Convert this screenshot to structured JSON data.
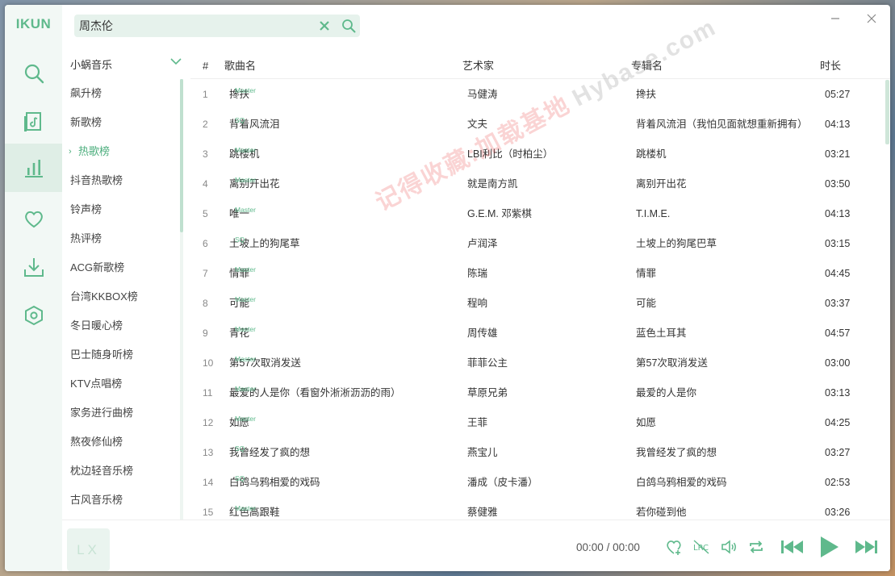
{
  "app": {
    "brand": "IKUN"
  },
  "search": {
    "value": "周杰伦",
    "placeholder": ""
  },
  "source": {
    "selected": "小蜗音乐"
  },
  "charts": [
    {
      "label": "飙升榜",
      "active": false
    },
    {
      "label": "新歌榜",
      "active": false
    },
    {
      "label": "热歌榜",
      "active": true
    },
    {
      "label": "抖音热歌榜",
      "active": false
    },
    {
      "label": "铃声榜",
      "active": false
    },
    {
      "label": "热评榜",
      "active": false
    },
    {
      "label": "ACG新歌榜",
      "active": false
    },
    {
      "label": "台湾KKBOX榜",
      "active": false
    },
    {
      "label": "冬日暖心榜",
      "active": false
    },
    {
      "label": "巴士随身听榜",
      "active": false
    },
    {
      "label": "KTV点唱榜",
      "active": false
    },
    {
      "label": "家务进行曲榜",
      "active": false
    },
    {
      "label": "熬夜修仙榜",
      "active": false
    },
    {
      "label": "枕边轻音乐榜",
      "active": false
    },
    {
      "label": "古风音乐榜",
      "active": false
    }
  ],
  "table": {
    "headers": {
      "num": "#",
      "name": "歌曲名",
      "artist": "艺术家",
      "album": "专辑名",
      "duration": "时长"
    },
    "rows": [
      {
        "num": "1",
        "name": "搀扶",
        "quality": "Master",
        "artist": "马健涛",
        "album": "搀扶",
        "duration": "05:27"
      },
      {
        "num": "2",
        "name": "背着风流泪",
        "quality": "SQ",
        "artist": "文夫",
        "album": "背着风流泪（我怕见面就想重新拥有）",
        "duration": "04:13"
      },
      {
        "num": "3",
        "name": "跳楼机",
        "quality": "Master",
        "artist": "LBI利比（时柏尘）",
        "album": "跳楼机",
        "duration": "03:21"
      },
      {
        "num": "4",
        "name": "离别开出花",
        "quality": "Master",
        "artist": "就是南方凯",
        "album": "离别开出花",
        "duration": "03:50"
      },
      {
        "num": "5",
        "name": "唯一",
        "quality": "Master",
        "artist": "G.E.M. 邓紫棋",
        "album": "T.I.M.E.",
        "duration": "04:13"
      },
      {
        "num": "6",
        "name": "土坡上的狗尾草",
        "quality": "SQ",
        "artist": "卢润泽",
        "album": "土坡上的狗尾巴草",
        "duration": "03:15"
      },
      {
        "num": "7",
        "name": "情罪",
        "quality": "Master",
        "artist": "陈瑞",
        "album": "情罪",
        "duration": "04:45"
      },
      {
        "num": "8",
        "name": "可能",
        "quality": "Master",
        "artist": "程响",
        "album": "可能",
        "duration": "03:37"
      },
      {
        "num": "9",
        "name": "青花",
        "quality": "Master",
        "artist": "周传雄",
        "album": "蓝色土耳其",
        "duration": "04:57"
      },
      {
        "num": "10",
        "name": "第57次取消发送",
        "quality": "Master",
        "artist": "菲菲公主",
        "album": "第57次取消发送",
        "duration": "03:00"
      },
      {
        "num": "11",
        "name": "最爱的人是你（看窗外淅淅沥沥的雨）",
        "quality": "Master",
        "artist": "草原兄弟",
        "album": "最爱的人是你",
        "duration": "03:13"
      },
      {
        "num": "12",
        "name": "如愿",
        "quality": "Master",
        "artist": "王菲",
        "album": "如愿",
        "duration": "04:25"
      },
      {
        "num": "13",
        "name": "我曾经发了疯的想",
        "quality": "SQ",
        "artist": "燕宝儿",
        "album": "我曾经发了疯的想",
        "duration": "03:27"
      },
      {
        "num": "14",
        "name": "白鸽乌鸦相爱的戏码",
        "quality": "SQ",
        "artist": "潘成（皮卡潘）",
        "album": "白鸽乌鸦相爱的戏码",
        "duration": "02:53"
      },
      {
        "num": "15",
        "name": "红色高跟鞋",
        "quality": "Master",
        "artist": "蔡健雅",
        "album": "若你碰到他",
        "duration": "03:26"
      }
    ]
  },
  "player": {
    "cover_text": "LX",
    "current_time": "00:00",
    "separator": "/",
    "total_time": "00:00"
  },
  "watermark": {
    "text": "记得收藏:加载基地",
    "sub": "Hybase.com"
  },
  "colors": {
    "accent": "#5fb98c",
    "rail_bg": "#f2f8f5",
    "active_bg": "#dfeee6",
    "search_bg": "#e6f2ec"
  }
}
